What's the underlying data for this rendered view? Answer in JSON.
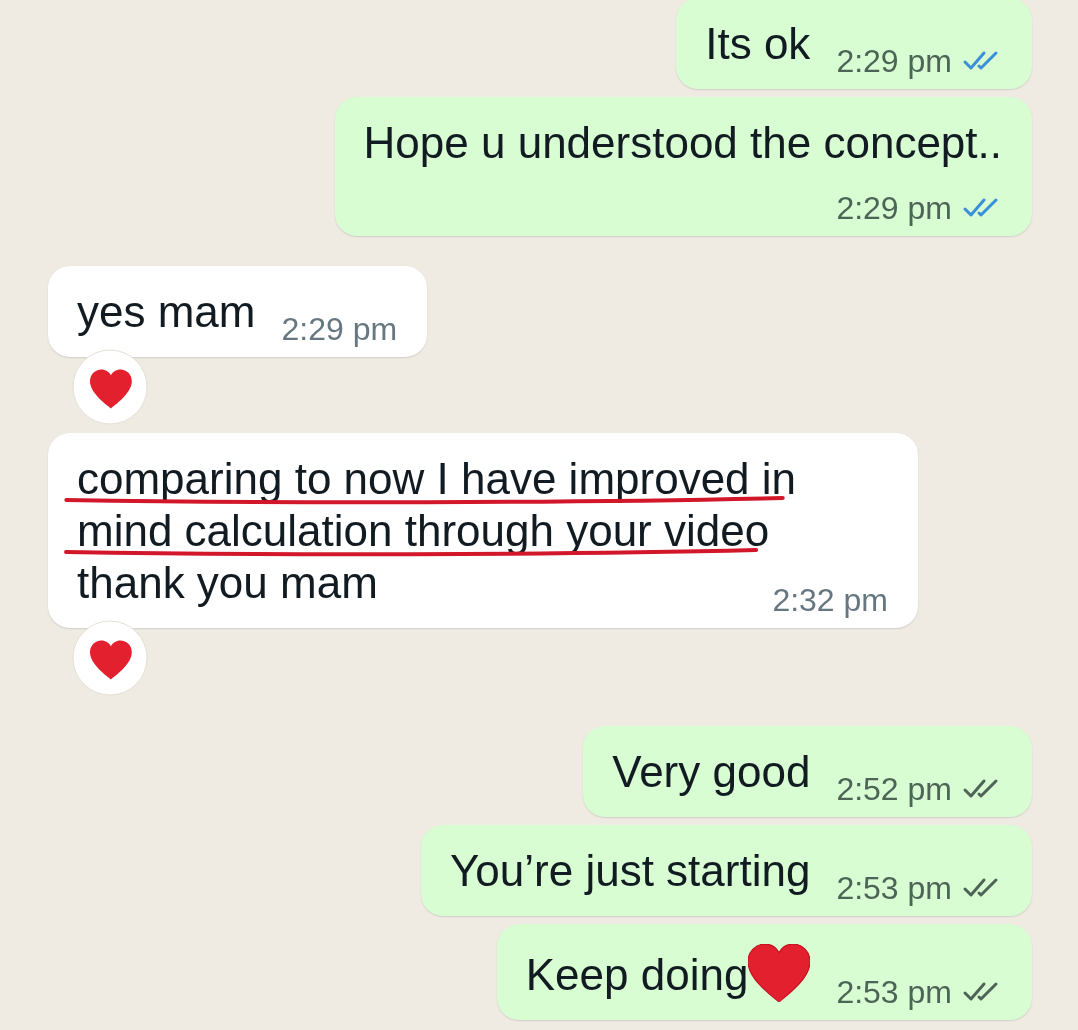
{
  "messages": [
    {
      "outgoing": true,
      "text": "Its ok",
      "time": "2:29 pm",
      "read": true
    },
    {
      "outgoing": true,
      "text": "Hope u understood the concept..",
      "time": "2:29 pm",
      "read": true
    },
    {
      "outgoing": false,
      "text": "yes mam",
      "time": "2:29 pm",
      "heart_reaction": true
    },
    {
      "outgoing": false,
      "lines": [
        {
          "text": "comparing to now I have improved in",
          "underlined": true
        },
        {
          "text": "mind calculation through your video",
          "underlined": true
        },
        {
          "text": "thank you mam",
          "underlined": false
        }
      ],
      "time": "2:32 pm",
      "heart_reaction": true
    },
    {
      "outgoing": true,
      "text": "Very good",
      "time": "2:52 pm",
      "read": false
    },
    {
      "outgoing": true,
      "text": "You’re just starting",
      "time": "2:53 pm",
      "read": false
    },
    {
      "outgoing": true,
      "text": "Keep doing",
      "time": "2:53 pm",
      "read": false,
      "heart_emoji": true
    }
  ]
}
